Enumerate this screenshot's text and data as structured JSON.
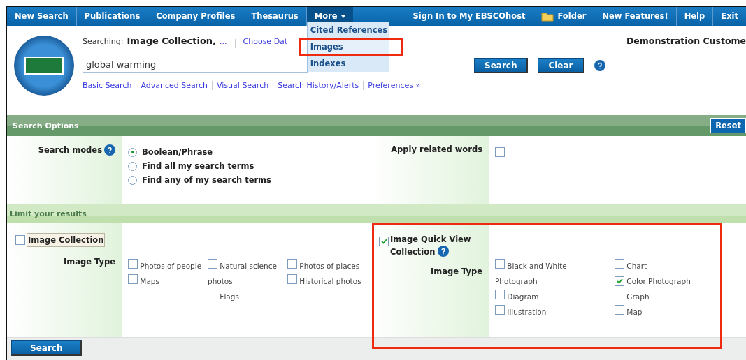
{
  "nav": {
    "left": [
      "New Search",
      "Publications",
      "Company Profiles",
      "Thesaurus"
    ],
    "more": {
      "label": "More",
      "expanded": true,
      "items": [
        {
          "label": "Cited References",
          "highlighted": false
        },
        {
          "label": "Images",
          "highlighted": true
        },
        {
          "label": "Indexes",
          "highlighted": false
        }
      ]
    },
    "right": [
      {
        "label": "Sign In to My EBSCOhost",
        "kind": "link"
      },
      {
        "label": "Folder",
        "kind": "folder"
      },
      {
        "label": "New Features!",
        "kind": "link"
      },
      {
        "label": "Help",
        "kind": "link"
      },
      {
        "label": "Exit",
        "kind": "link"
      }
    ]
  },
  "header": {
    "searching_label": "Searching:",
    "database": "Image Collection,",
    "more_link": "...",
    "choose_link": "Choose Dat",
    "query": "global warming",
    "search_button": "Search",
    "clear_button": "Clear",
    "links": [
      "Basic Search",
      "Advanced Search",
      "Visual Search",
      "Search History/Alerts",
      "Preferences »"
    ],
    "customer": "Demonstration Custome"
  },
  "search_options": {
    "title": "Search Options",
    "reset_button": "Reset",
    "modes_label": "Search modes",
    "modes": [
      {
        "label": "Boolean/Phrase",
        "selected": true
      },
      {
        "label": "Find all my search terms",
        "selected": false
      },
      {
        "label": "Find any of my search terms",
        "selected": false
      }
    ],
    "related_label": "Apply related words",
    "related_checked": false
  },
  "limits": {
    "title": "Limit your results",
    "collections": [
      {
        "name": "Image Collection",
        "checked": false,
        "help": false,
        "highlighted": false,
        "type_label": "Image Type",
        "type_columns": [
          [
            {
              "label": "Photos of people",
              "checked": false
            },
            {
              "label": "Maps",
              "checked": false
            }
          ],
          [
            {
              "label": "Natural science photos",
              "checked": false
            },
            {
              "label": "Flags",
              "checked": false
            }
          ],
          [
            {
              "label": "Photos of places",
              "checked": false
            },
            {
              "label": "Historical photos",
              "checked": false
            }
          ]
        ]
      },
      {
        "name": "Image Quick View Collection",
        "checked": true,
        "help": true,
        "highlighted": true,
        "type_label": "Image Type",
        "type_columns": [
          [
            {
              "label": "Black and White Photograph",
              "checked": false
            },
            {
              "label": "Diagram",
              "checked": false
            },
            {
              "label": "Illustration",
              "checked": false
            }
          ],
          [
            {
              "label": "Chart",
              "checked": false
            },
            {
              "label": "Color Photograph",
              "checked": true
            },
            {
              "label": "Graph",
              "checked": false
            },
            {
              "label": "Map",
              "checked": false
            }
          ]
        ]
      }
    ]
  },
  "footer": {
    "search_button": "Search"
  }
}
